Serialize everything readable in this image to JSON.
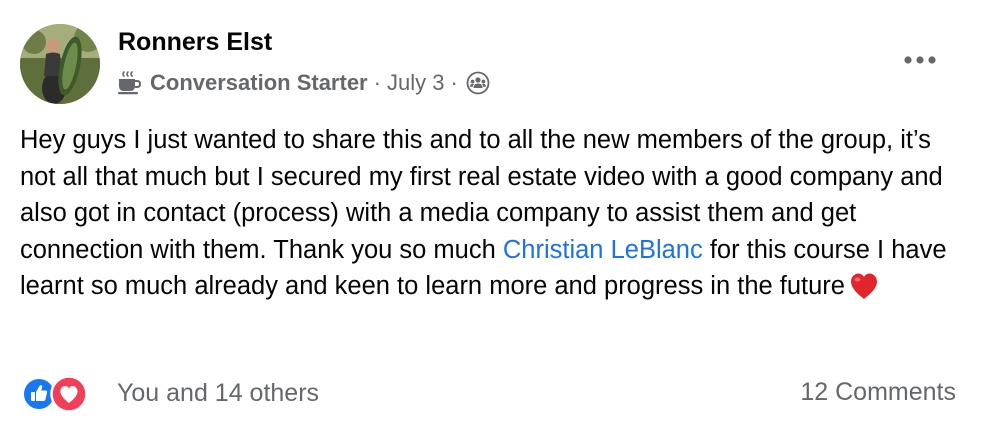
{
  "post": {
    "author": "Ronners Elst",
    "badge": {
      "icon": "coffee-cup-icon",
      "label": "Conversation Starter"
    },
    "separator": "·",
    "date": "July 3",
    "audience_icon": "group-members-icon",
    "more_icon": "more-options-icon",
    "body": {
      "text_before": "Hey guys I just wanted to share this and to all the new members of the group, it’s not all that much but I secured my first real estate video with a good company and also got in contact (process) with a media company to assist them and get connection with them. Thank you so much ",
      "mention": "Christian LeBlanc",
      "text_after": " for this course I have learnt so much already and keen to learn more and progress in the future",
      "emoji": "red-heart-emoji"
    },
    "reactions": {
      "icons": [
        "like-reaction-icon",
        "love-reaction-icon"
      ],
      "summary": "You and 14 others"
    },
    "comments": "12 Comments"
  },
  "colors": {
    "text_primary": "#050505",
    "text_secondary": "#65676b",
    "mention": "#1b74e4",
    "like_blue": "#1877f2",
    "love_red": "#f33e58"
  }
}
